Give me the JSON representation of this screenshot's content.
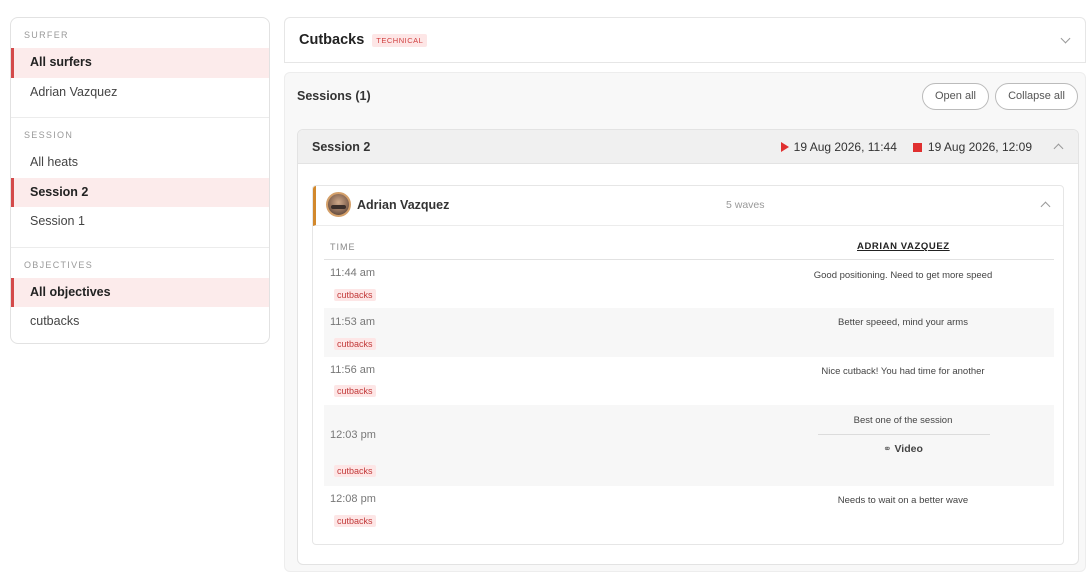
{
  "sidebar": {
    "surfer_heading": "SURFER",
    "surfers": [
      {
        "label": "All surfers"
      },
      {
        "label": "Adrian Vazquez"
      }
    ],
    "session_heading": "SESSION",
    "sessions": [
      {
        "label": "All heats"
      },
      {
        "label": "Session 2"
      },
      {
        "label": "Session 1"
      }
    ],
    "objectives_heading": "OBJECTIVES",
    "objectives": [
      {
        "label": "All objectives"
      },
      {
        "label": "cutbacks"
      }
    ]
  },
  "objective": {
    "title": "Cutbacks",
    "tag": "TECHNICAL"
  },
  "sessions_panel": {
    "title": "Sessions (1)",
    "open_all": "Open all",
    "collapse_all": "Collapse all"
  },
  "session": {
    "name": "Session 2",
    "start": "19 Aug 2026, 11:44",
    "end": "19 Aug 2026, 12:09"
  },
  "surfer_card": {
    "name": "Adrian Vazquez",
    "waves": "5 waves",
    "col_time": "TIME",
    "col_surfer": "ADRIAN VAZQUEZ"
  },
  "wave_rows": [
    {
      "time": "11:44 am",
      "tag": "cutbacks",
      "note": "Good positioning. Need to get more speed"
    },
    {
      "time": "11:53 am",
      "tag": "cutbacks",
      "note": "Better speeed, mind your arms"
    },
    {
      "time": "11:56 am",
      "tag": "cutbacks",
      "note": "Nice cutback! You had time for another"
    },
    {
      "time": "12:03 pm",
      "tag": "cutbacks",
      "note": "Best one of the session",
      "video": "Video"
    },
    {
      "time": "12:08 pm",
      "tag": "cutbacks",
      "note": "Needs to wait on a better wave"
    }
  ],
  "colors": {
    "accent_red": "#d44a4a",
    "active_bg": "#fcebeb",
    "surfer_bar": "#d2882c",
    "tag_bg": "#fde6e6",
    "tag_text": "#c23a3a"
  },
  "icons": {
    "play": "play-icon",
    "stop": "stop-icon",
    "link": "link-icon",
    "chevron_down": "chevron-down-icon",
    "chevron_up": "chevron-up-icon"
  }
}
